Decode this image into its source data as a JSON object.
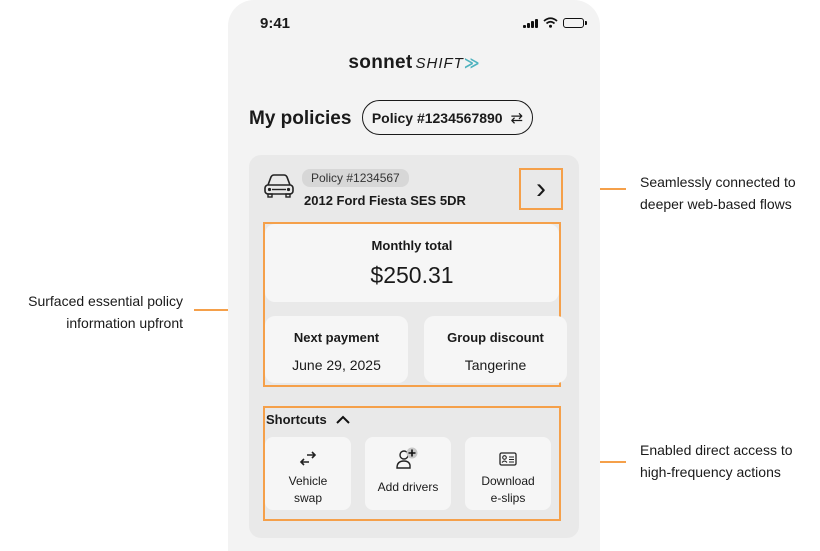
{
  "status_bar": {
    "time": "9:41"
  },
  "brand": {
    "main": "sonnet",
    "sub": "SHIFT",
    "arrows": "≫"
  },
  "header": {
    "title": "My policies",
    "policy_pill": "Policy #1234567890",
    "swap_glyph": "⇄"
  },
  "policy_card": {
    "badge": "Policy #1234567",
    "vehicle": "2012 Ford Fiesta SES 5DR",
    "chevron": "›",
    "monthly_label": "Monthly total",
    "monthly_value": "$250.31",
    "next_payment_label": "Next payment",
    "next_payment_value": "June 29, 2025",
    "discount_label": "Group discount",
    "discount_value": "Tangerine"
  },
  "shortcuts": {
    "title": "Shortcuts",
    "items": [
      {
        "line1": "Vehicle",
        "line2": "swap",
        "icon": "vehicle-swap-icon"
      },
      {
        "line1": "Add drivers",
        "line2": "",
        "icon": "add-driver-icon"
      },
      {
        "line1": "Download",
        "line2": "e-slips",
        "icon": "id-card-icon"
      }
    ]
  },
  "annotations": {
    "right_top": [
      "Seamlessly connected to",
      "deeper web-based flows"
    ],
    "left": [
      "Surfaced essential policy",
      "information upfront"
    ],
    "right_bottom": [
      "Enabled direct access to",
      "high-frequency actions"
    ]
  },
  "colors": {
    "highlight": "#f5a04a",
    "brand_accent": "#4fb3bf",
    "phone_bg": "#f3f3f3",
    "card_bg": "#e9e9e9"
  }
}
